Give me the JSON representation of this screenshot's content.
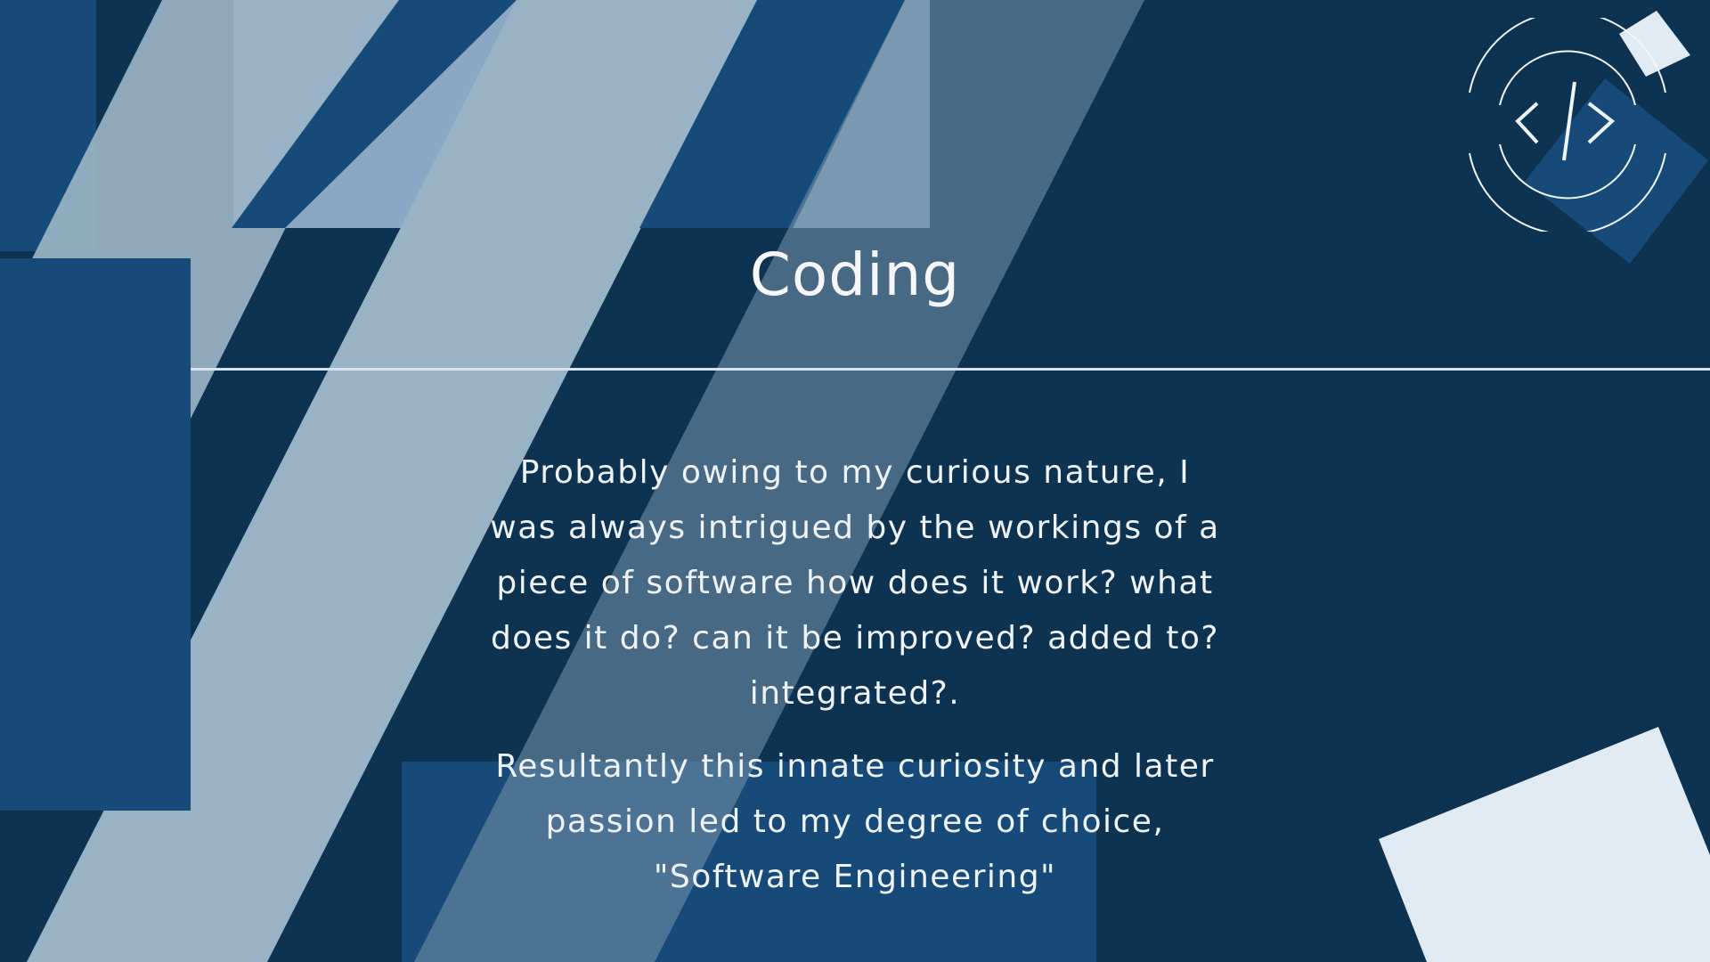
{
  "slide": {
    "title": "Coding",
    "paragraphs": [
      "Probably owing to my curious nature, I was always intrigued by the workings of a piece of software how does it work? what does it do? can it be improved? added to? integrated?.",
      "Resultantly this innate curiosity and later passion led to my degree of choice, \"Software Engineering\""
    ]
  },
  "logo": {
    "icon": "code-brackets-icon",
    "glyph": "</>"
  },
  "colors": {
    "background": "#0d3350",
    "navy_block": "#174a78",
    "light_stripe": "#9ab3c4",
    "mid_stripe": "#4a6c84",
    "pale_block": "#e0ebf4",
    "text": "#f5f7fa"
  }
}
